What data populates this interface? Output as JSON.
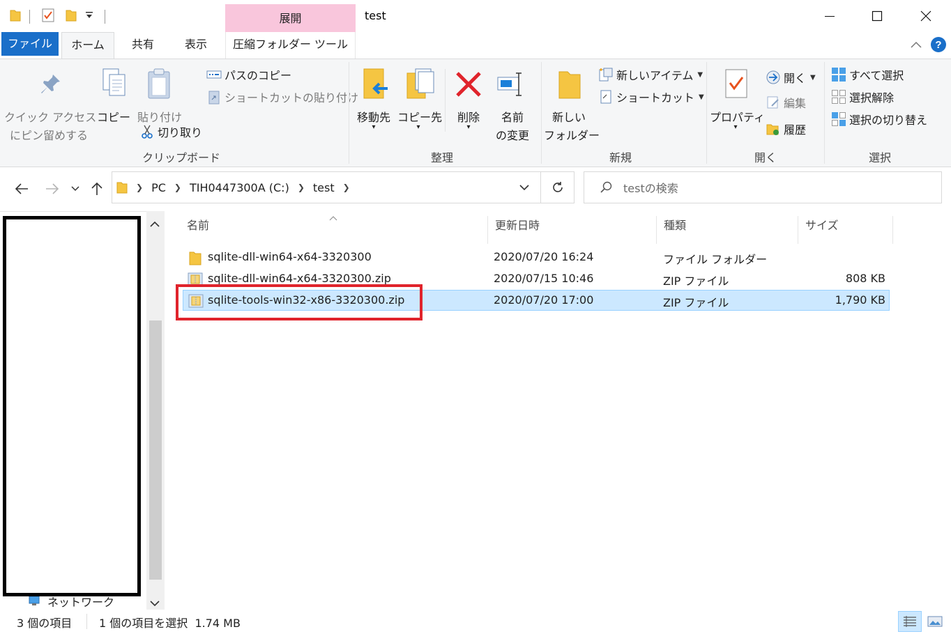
{
  "window": {
    "title": "test",
    "context_header": "展開"
  },
  "ribbon_tabs": {
    "file": "ファイル",
    "home": "ホーム",
    "share": "共有",
    "view": "表示",
    "compressed_tools": "圧縮フォルダー ツール"
  },
  "ribbon": {
    "clipboard": {
      "group_label": "クリップボード",
      "pin_line1": "クイック アクセス",
      "pin_line2": "にピン留めする",
      "copy": "コピー",
      "paste": "貼り付け",
      "copy_path": "パスのコピー",
      "paste_shortcut": "ショートカットの貼り付け",
      "cut": "切り取り"
    },
    "organize": {
      "group_label": "整理",
      "move_to": "移動先",
      "copy_to": "コピー先",
      "delete": "削除",
      "rename_line1": "名前",
      "rename_line2": "の変更"
    },
    "new": {
      "group_label": "新規",
      "new_folder_line1": "新しい",
      "new_folder_line2": "フォルダー",
      "new_item": "新しいアイテム",
      "easy_access": "ショートカット"
    },
    "open": {
      "group_label": "開く",
      "properties": "プロパティ",
      "open": "開く",
      "edit": "編集",
      "history": "履歴"
    },
    "select": {
      "group_label": "選択",
      "select_all": "すべて選択",
      "select_none": "選択解除",
      "invert_selection": "選択の切り替え"
    }
  },
  "address": {
    "crumbs": [
      "PC",
      "TIH0447300A (C:)",
      "test"
    ],
    "search_placeholder": "testの検索"
  },
  "nav_pane": {
    "network": "ネットワーク"
  },
  "columns": {
    "name": "名前",
    "modified": "更新日時",
    "type": "種類",
    "size": "サイズ"
  },
  "files": [
    {
      "name": "sqlite-dll-win64-x64-3320300",
      "modified": "2020/07/20 16:24",
      "type": "ファイル フォルダー",
      "size": "",
      "icon": "folder-icon"
    },
    {
      "name": "sqlite-dll-win64-x64-3320300.zip",
      "modified": "2020/07/15 10:46",
      "type": "ZIP ファイル",
      "size": "808 KB",
      "icon": "zip-icon"
    },
    {
      "name": "sqlite-tools-win32-x86-3320300.zip",
      "modified": "2020/07/20 17:00",
      "type": "ZIP ファイル",
      "size": "1,790 KB",
      "icon": "zip-icon"
    }
  ],
  "status": {
    "item_count": "3 個の項目",
    "selection": "1 個の項目を選択  1.74 MB"
  },
  "colors": {
    "file_tab": "#1a6fc9",
    "context_tab": "#f9c6dc",
    "selection": "#cce8ff",
    "highlight_box": "#e0242c"
  }
}
